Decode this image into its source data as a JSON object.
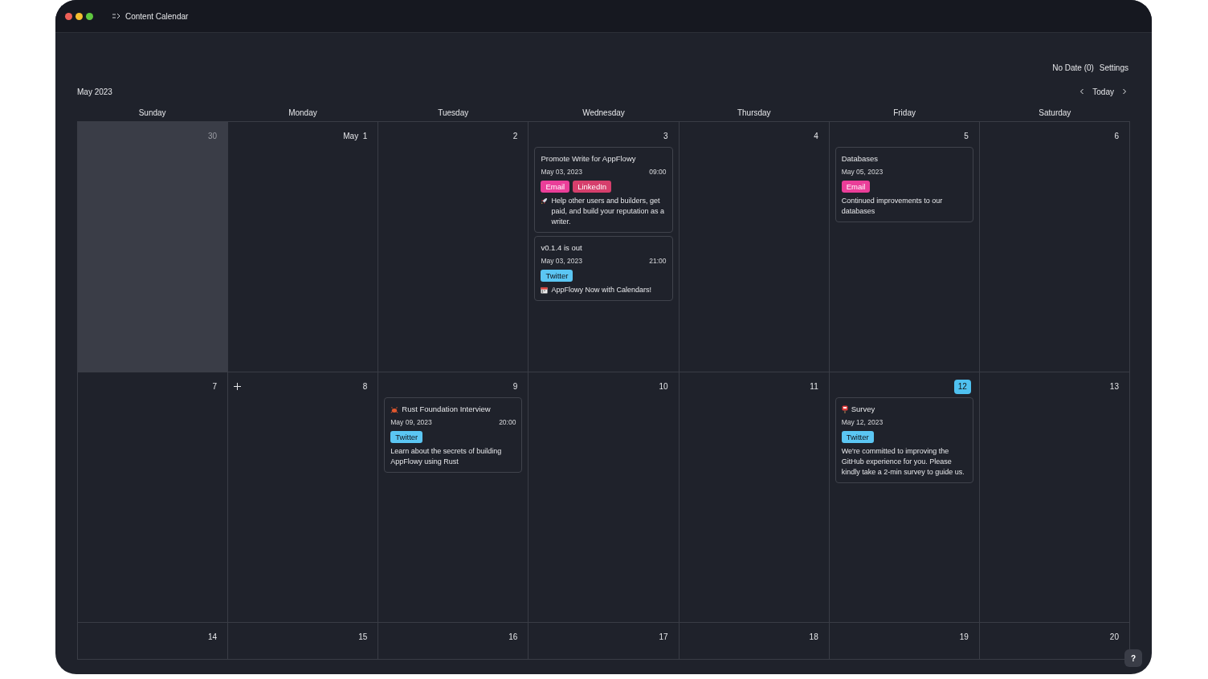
{
  "window": {
    "title": "Content Calendar"
  },
  "toolbar": {
    "items": [
      "No Date (0)",
      "Settings"
    ]
  },
  "header": {
    "month": "May 2023",
    "today_button": "Today"
  },
  "weekdays": [
    "Sunday",
    "Monday",
    "Tuesday",
    "Wednesday",
    "Thursday",
    "Friday",
    "Saturday"
  ],
  "weeks": [
    {
      "days": [
        {
          "label": "30",
          "other_month": true,
          "today": false,
          "add_button": false
        },
        {
          "label": "May  1",
          "other_month": false,
          "today": false,
          "add_button": false
        },
        {
          "label": "2",
          "other_month": false,
          "today": false,
          "add_button": false
        },
        {
          "label": "3",
          "other_month": false,
          "today": false,
          "add_button": false,
          "events": [
            {
              "kind": "rocket",
              "title": "Promote Write for AppFlowy",
              "date": "May 03, 2023",
              "time": "09:00",
              "tags": [
                {
                  "label": "Email",
                  "color": "#ea3e99"
                },
                {
                  "label": "LinkedIn",
                  "color": "#d63f6c"
                }
              ],
              "description": "Help other users and builders, get paid, and build your reputation as a writer."
            },
            {
              "kind": "calendar",
              "title": "v0.1.4 is out",
              "date": "May 03, 2023",
              "time": "21:00",
              "tags": [
                {
                  "label": "Twitter",
                  "color": "#5bc6f3"
                }
              ],
              "description": "AppFlowy Now with Calendars!"
            }
          ]
        },
        {
          "label": "4",
          "other_month": false,
          "today": false,
          "add_button": false
        },
        {
          "label": "5",
          "other_month": false,
          "today": false,
          "add_button": false,
          "events": [
            {
              "kind": "plain",
              "title": "Databases",
              "date": "May 05, 2023",
              "tags": [
                {
                  "label": "Email",
                  "color": "#ea3e99"
                }
              ],
              "description": "Continued improvements to our databases"
            }
          ]
        },
        {
          "label": "6",
          "other_month": false,
          "today": false,
          "add_button": false
        }
      ]
    },
    {
      "days": [
        {
          "label": "7",
          "other_month": false,
          "today": false,
          "add_button": false
        },
        {
          "label": "8",
          "other_month": false,
          "today": false,
          "add_button": true
        },
        {
          "label": "9",
          "other_month": false,
          "today": false,
          "add_button": false,
          "events": [
            {
              "kind": "crab",
              "title": "Rust Foundation Interview",
              "date": "May 09, 2023",
              "time": "20:00",
              "tags": [
                {
                  "label": "Twitter",
                  "color": "#5bc6f3"
                }
              ],
              "description": "Learn about the secrets of building AppFlowy using Rust"
            }
          ]
        },
        {
          "label": "10",
          "other_month": false,
          "today": false,
          "add_button": false
        },
        {
          "label": "11",
          "other_month": false,
          "today": false,
          "add_button": false
        },
        {
          "label": "12",
          "other_month": false,
          "today": true,
          "add_button": false,
          "events": [
            {
              "kind": "mailbox",
              "title": "Survey",
              "date": "May 12, 2023",
              "tags": [
                {
                  "label": "Twitter",
                  "color": "#5bc6f3"
                }
              ],
              "description": "We're committed to improving the GitHub experience for you. Please kindly take a 2-min survey to guide us."
            }
          ]
        },
        {
          "label": "13",
          "other_month": false,
          "today": false,
          "add_button": false
        }
      ]
    },
    {
      "days": [
        {
          "label": "14",
          "other_month": false,
          "today": false,
          "add_button": false
        },
        {
          "label": "15",
          "other_month": false,
          "today": false,
          "add_button": false
        },
        {
          "label": "16",
          "other_month": false,
          "today": false,
          "add_button": false
        },
        {
          "label": "17",
          "other_month": false,
          "today": false,
          "add_button": false
        },
        {
          "label": "18",
          "other_month": false,
          "today": false,
          "add_button": false
        },
        {
          "label": "19",
          "other_month": false,
          "today": false,
          "add_button": false
        },
        {
          "label": "20",
          "other_month": false,
          "today": false,
          "add_button": false
        }
      ]
    }
  ],
  "help_button": "?"
}
